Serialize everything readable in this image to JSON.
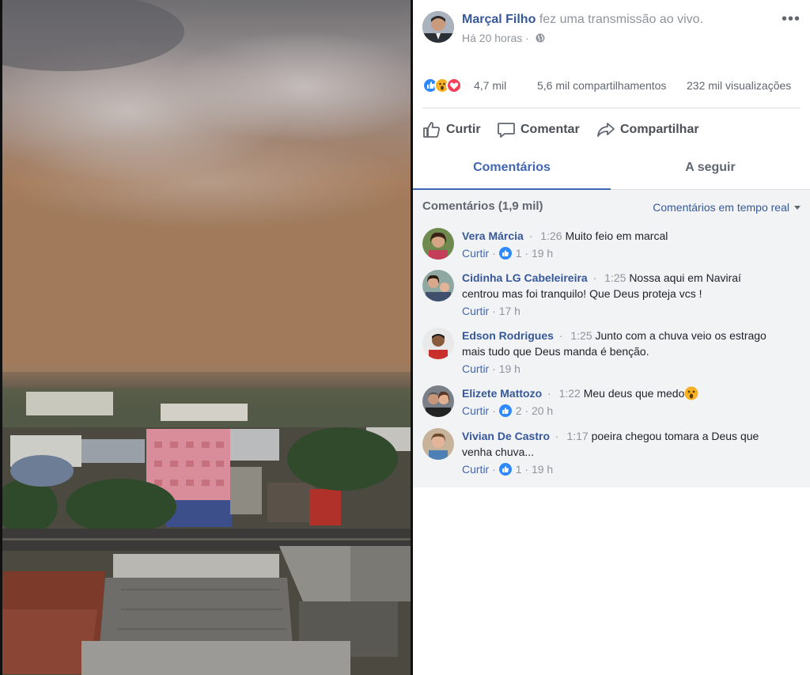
{
  "post": {
    "author": "Marçal Filho",
    "action": "fez uma transmissão ao vivo.",
    "time": "Há 20 horas",
    "reaction_icons": [
      "like-icon",
      "wow-icon",
      "love-icon"
    ],
    "reactions_count": "4,7 mil",
    "shares": "5,6 mil compartilhamentos",
    "views": "232 mil visualizações"
  },
  "actions": {
    "like": "Curtir",
    "comment": "Comentar",
    "share": "Compartilhar"
  },
  "tabs": {
    "comments": "Comentários",
    "following": "A seguir"
  },
  "comments_header": {
    "count": "Comentários (1,9 mil)",
    "filter": "Comentários em tempo real"
  },
  "comments": [
    {
      "author": "Vera Márcia",
      "time": "1:26",
      "text": "Muito feio em marcal",
      "like_label": "Curtir",
      "likes": "1",
      "age": "19 h"
    },
    {
      "author": "Cidinha LG Cabeleireira",
      "time": "1:25",
      "text": "Nossa aqui em Naviraí centrou mas foi tranquilo! Que Deus proteja vcs !",
      "like_label": "Curtir",
      "likes": "",
      "age": "17 h"
    },
    {
      "author": "Edson Rodrigues",
      "time": "1:25",
      "text": "Junto com a chuva veio os estrago mais tudo que Deus manda é benção.",
      "like_label": "Curtir",
      "likes": "",
      "age": "19 h"
    },
    {
      "author": "Elizete Mattozo",
      "time": "1:22",
      "text": "Meu deus que medo",
      "like_label": "Curtir",
      "likes": "2",
      "age": "20 h"
    },
    {
      "author": "Vivian De Castro",
      "time": "1:17",
      "text": "poeira chegou tomara a Deus que venha chuva...",
      "like_label": "Curtir",
      "likes": "1",
      "age": "19 h"
    }
  ],
  "colors": {
    "link": "#365899",
    "accent": "#4267b2",
    "muted": "#90949c",
    "like_blue": "#2e89ff",
    "comments_bg": "#f2f3f5"
  }
}
